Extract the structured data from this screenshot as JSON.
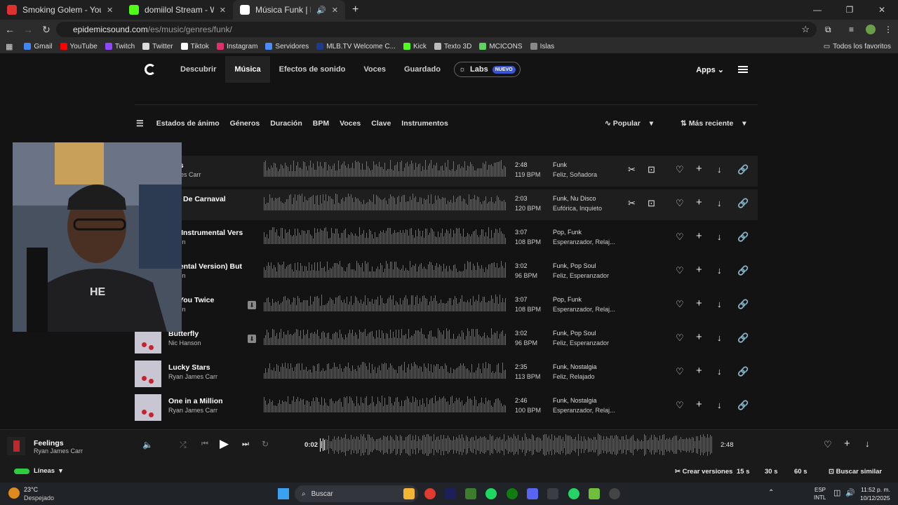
{
  "browser": {
    "tabs": [
      {
        "title": "Smoking Golem - YouTube",
        "color": "#e03131"
      },
      {
        "title": "domiilol Stream - Watch Live o",
        "color": "#53fc18"
      },
      {
        "title": "Música Funk | Descarga sin",
        "color": "#ffffff"
      }
    ],
    "url_host": "epidemicsound.com",
    "url_path": "/es/music/genres/funk/",
    "bookmarks": [
      {
        "label": "Gmail",
        "color": "#4285f4"
      },
      {
        "label": "YouTube",
        "color": "#ff0000"
      },
      {
        "label": "Twitch",
        "color": "#9146ff"
      },
      {
        "label": "Twitter",
        "color": "#dddddd"
      },
      {
        "label": "Tiktok",
        "color": "#ffffff"
      },
      {
        "label": "Instagram",
        "color": "#e1306c"
      },
      {
        "label": "Servidores",
        "color": "#4a8cff"
      },
      {
        "label": "MLB.TV Welcome C...",
        "color": "#1e3a8a"
      },
      {
        "label": "Kick",
        "color": "#53fc18"
      },
      {
        "label": "Texto 3D",
        "color": "#bbbbbb"
      },
      {
        "label": "MCICONS",
        "color": "#5fd35f"
      },
      {
        "label": "Islas",
        "color": "#888888"
      }
    ],
    "all_bookmarks": "Todos los favoritos"
  },
  "site": {
    "nav": [
      "Descubrir",
      "Música",
      "Efectos de sonido",
      "Voces",
      "Guardado"
    ],
    "labs": "Labs",
    "labs_badge": "NUEVO",
    "apps": "Apps",
    "filters": [
      "Estados de ánimo",
      "Géneros",
      "Duración",
      "BPM",
      "Voces",
      "Clave",
      "Instrumentos"
    ],
    "sort_popular": "Popular",
    "sort_recent": "Más reciente"
  },
  "tracks": [
    {
      "title": "ings",
      "artist": "James Carr",
      "duration": "2:48",
      "bpm": "119 BPM",
      "genres": "Funk",
      "moods": "Feliz, Soñadora"
    },
    {
      "title": "ove De Carnaval",
      "artist": "w",
      "duration": "2:03",
      "bpm": "120 BPM",
      "genres": "Funk, Nu Disco",
      "moods": "Eufórica, Inquieto"
    },
    {
      "title": "ce (Instrumental Vers",
      "artist": "anson",
      "duration": "3:07",
      "bpm": "108 BPM",
      "genres": "Pop, Funk",
      "moods": "Esperanzador, Relaj..."
    },
    {
      "title": "umental Version)  But",
      "artist": "anson",
      "duration": "3:02",
      "bpm": "96 BPM",
      "genres": "Funk, Pop Soul",
      "moods": "Feliz, Esperanzador"
    },
    {
      "title": "ed You Twice",
      "artist": "anson",
      "duration": "3:07",
      "bpm": "108 BPM",
      "genres": "Pop, Funk",
      "moods": "Esperanzador, Relaj..."
    },
    {
      "title": "Butterfly",
      "artist": "Nic Hanson",
      "duration": "3:02",
      "bpm": "96 BPM",
      "genres": "Funk, Pop Soul",
      "moods": "Feliz, Esperanzador"
    },
    {
      "title": "Lucky Stars",
      "artist": "Ryan James Carr",
      "duration": "2:35",
      "bpm": "113 BPM",
      "genres": "Funk, Nostalgia",
      "moods": "Feliz, Relajado"
    },
    {
      "title": "One in a Million",
      "artist": "Ryan James Carr",
      "duration": "2:46",
      "bpm": "100 BPM",
      "genres": "Funk, Nostalgia",
      "moods": "Esperanzador, Relaj..."
    }
  ],
  "player": {
    "title": "Feelings",
    "artist": "Ryan James Carr",
    "elapsed": "0:02",
    "total": "2:48",
    "progress": 0.012,
    "lines": "Líneas",
    "create_versions": "Crear versiones",
    "len15": "15 s",
    "len30": "30 s",
    "len60": "60 s",
    "search_similar": "Buscar similar"
  },
  "taskbar": {
    "temp": "23°C",
    "weather": "Despejado",
    "search": "Buscar",
    "lang": "ESP",
    "layout": "INTL",
    "time": "11:52 p. m.",
    "date": "10/12/2025"
  }
}
